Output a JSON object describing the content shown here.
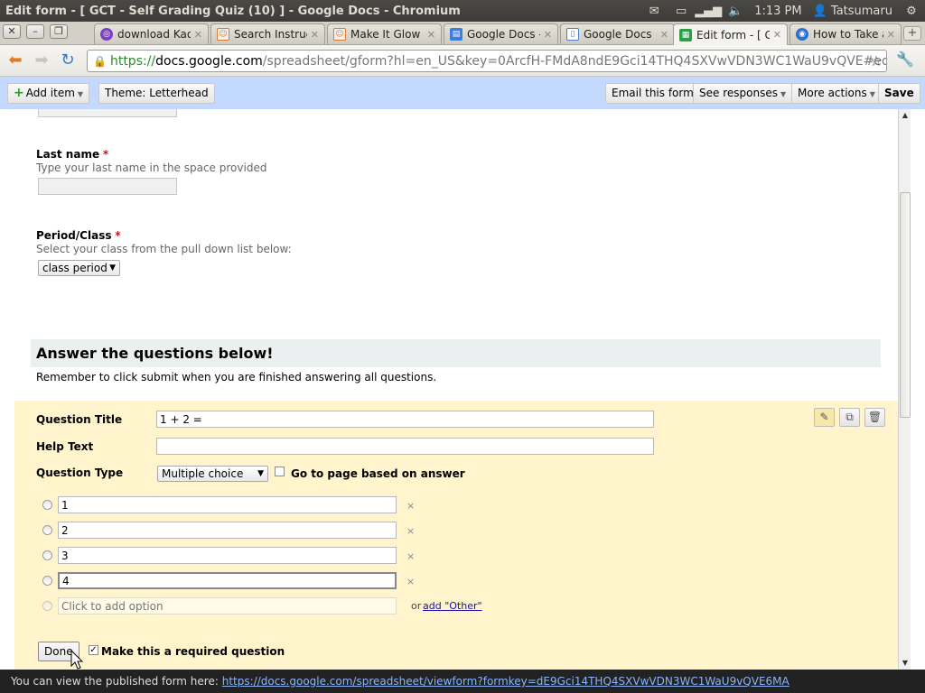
{
  "os_panel": {
    "window_title": "Edit form - [ GCT - Self Grading Quiz (10) ] - Google Docs - Chromium",
    "clock": "1:13 PM",
    "user": "Tatsumaru",
    "icons": [
      "mail-icon",
      "battery-icon",
      "network-icon",
      "volume-icon",
      "user-icon",
      "power-gear-icon"
    ]
  },
  "tabs": [
    {
      "label": "download Kao",
      "favicon": "purple-circle",
      "active": false
    },
    {
      "label": "Search Instruc",
      "favicon": "orange-robot",
      "active": false
    },
    {
      "label": "Make It Glow",
      "favicon": "orange-robot",
      "active": false
    },
    {
      "label": "Google Docs -",
      "favicon": "blue-doc",
      "active": false
    },
    {
      "label": "Google Docs",
      "favicon": "doc-page",
      "active": false
    },
    {
      "label": "Edit form - [ G",
      "favicon": "green-sheet",
      "active": true
    },
    {
      "label": "How to Take a",
      "favicon": "blue-globe",
      "active": false
    }
  ],
  "address": {
    "scheme": "https://",
    "host": "docs.google.com",
    "path": "/spreadsheet/gform?hl=en_US&key=0ArcfH-FMdA8ndE9Gci14THQ4SXVwVDN3WC1WaU9vQVE#edi"
  },
  "formbar": {
    "add_item": "Add item",
    "theme": "Theme:  Letterhead",
    "email": "Email this form",
    "see_responses": "See responses",
    "more_actions": "More actions",
    "save": "Save"
  },
  "fields": {
    "last_name": {
      "label": "Last name",
      "required": "*",
      "help": "Type your last name in the space provided"
    },
    "period": {
      "label": "Period/Class",
      "required": "*",
      "help": "Select your class from the pull down list below:",
      "selected": "class period"
    }
  },
  "section": {
    "title": "Answer the questions below!",
    "desc": "Remember to click submit when you are finished answering all questions."
  },
  "editor": {
    "question_title_label": "Question Title",
    "question_title_value": "1 + 2 =",
    "help_text_label": "Help Text",
    "help_text_value": "",
    "question_type_label": "Question Type",
    "question_type_value": "Multiple choice",
    "go_to_page_label": "Go to page based on answer",
    "options": [
      "1",
      "2",
      "3",
      "4"
    ],
    "add_option_placeholder": "Click to add option",
    "or_text": "or",
    "add_other": "add \"Other\"",
    "done": "Done",
    "required_label": "Make this a required question"
  },
  "status": {
    "text": "You can view the published form here:",
    "link": "https://docs.google.com/spreadsheet/viewform?formkey=dE9Gci14THQ4SXVwVDN3WC1WaU9vQVE6MA"
  }
}
